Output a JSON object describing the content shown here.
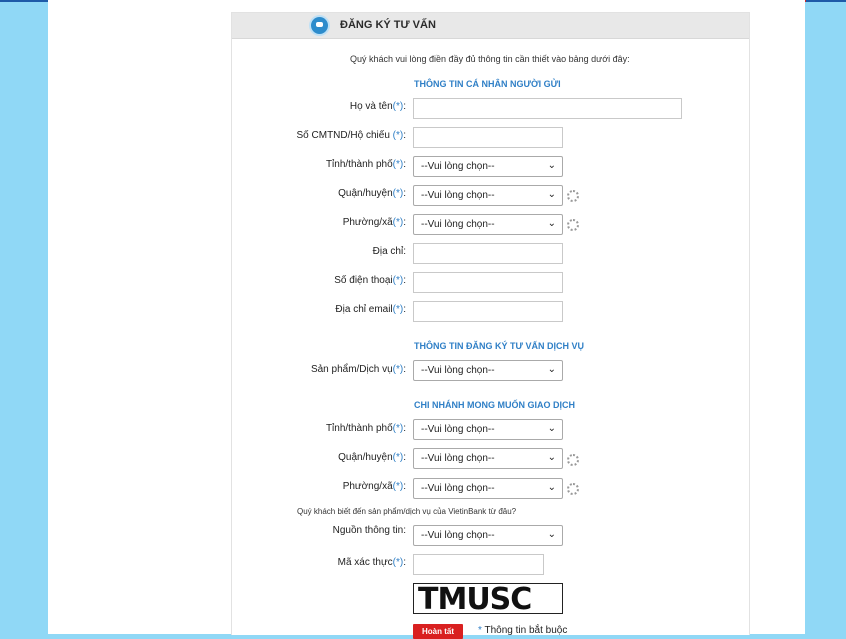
{
  "header": {
    "title": "ĐĂNG KÝ TƯ VẤN"
  },
  "intro": "Quý khách vui lòng điền đầy đủ thông tin cần thiết vào bảng dưới đây:",
  "sections": {
    "personal": "THÔNG TIN CÁ NHÂN NGƯỜI GỬI",
    "service": "THÔNG TIN ĐĂNG KÝ TƯ VẤN DỊCH VỤ",
    "branch": "CHI NHÁNH MONG MUỐN GIAO DỊCH"
  },
  "required_mark": "(*)",
  "labels": {
    "name": "Họ và tên",
    "id_number": "Số CMTND/Hộ chiếu",
    "province": "Tỉnh/thành phố",
    "district": "Quận/huyện",
    "ward": "Phường/xã",
    "address": "Địa chỉ:",
    "phone": "Số điện thoại",
    "email": "Địa chỉ email",
    "product": "Sản phẩm/Dịch vụ",
    "branch_province": "Tỉnh/thành phố",
    "branch_district": "Quận/huyện",
    "branch_ward": "Phường/xã",
    "source": "Nguồn thông tin:",
    "captcha": "Mã xác thực"
  },
  "colon": ":",
  "select_placeholder": "--Vui lòng chọn--",
  "question": "Quý khách biết đến sản phẩm/dịch vụ của VietinBank từ đâu?",
  "captcha_text": "TMUSC",
  "submit_label": "Hoàn tất",
  "required_note_star": "*",
  "required_note": "Thông tin bắt buộc",
  "colors": {
    "accent": "#2f7fc6",
    "submit": "#d92020",
    "background": "#90d8f6"
  }
}
